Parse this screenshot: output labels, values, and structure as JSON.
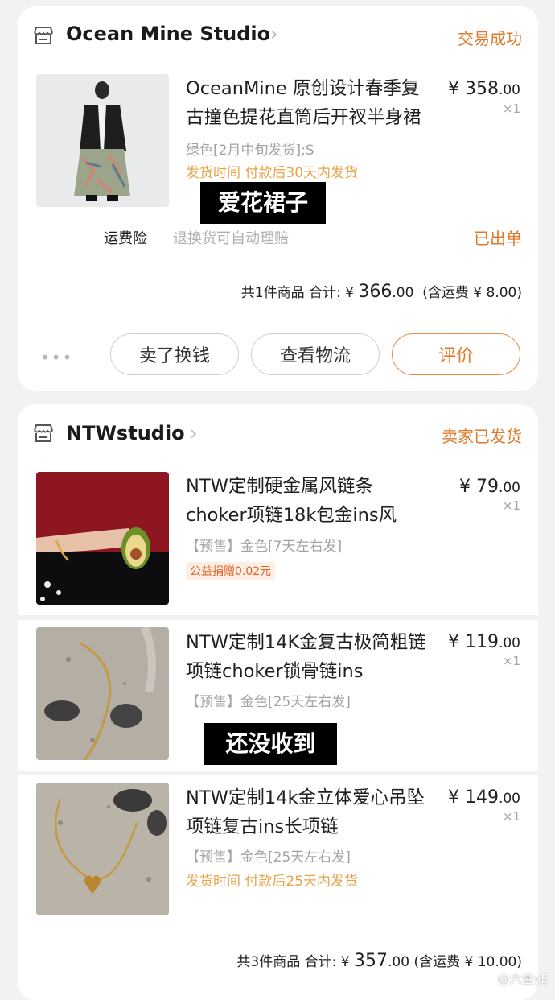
{
  "orders": [
    {
      "shop": {
        "name": "Ocean Mine Studio",
        "status": "交易成功"
      },
      "items": [
        {
          "title": "OceanMine 原创设计春季复古撞色提花直筒后开衩半身裙",
          "spec": "绿色[2月中旬发货];S",
          "ship_time": "发货时间 付款后30天内发货",
          "price_int": "¥ 358",
          "price_dec": ".00",
          "qty": "×1"
        }
      ],
      "overlay": "爱花裙子",
      "insurance": {
        "label": "运费险",
        "desc": "退换货可自动理赔",
        "status": "已出单"
      },
      "summary": {
        "count": "共1件商品",
        "total_label": "合计: ¥",
        "total_int": "366",
        "total_dec": ".00",
        "shipping": "(含运费 ¥ 8.00)"
      },
      "buttons": {
        "more": "•••",
        "sell": "卖了换钱",
        "logistics": "查看物流",
        "review": "评价"
      }
    },
    {
      "shop": {
        "name": "NTWstudio",
        "status": "卖家已发货"
      },
      "items": [
        {
          "title": "NTW定制硬金属风链条 choker项链18k包金ins风",
          "spec": "【预售】金色[7天左右发]",
          "charity": "公益捐赠0.02元",
          "price_int": "¥ 79",
          "price_dec": ".00",
          "qty": "×1"
        },
        {
          "title": "NTW定制14K金复古极简粗链项链choker锁骨链ins",
          "spec": "【预售】金色[25天左右发]",
          "price_int": "¥ 119",
          "price_dec": ".00",
          "qty": "×1"
        },
        {
          "title": "NTW定制14k金立体爱心吊坠项链复古ins长项链",
          "spec": "【预售】金色[25天左右发]",
          "ship_time": "发货时间 付款后25天内发货",
          "price_int": "¥ 149",
          "price_dec": ".00",
          "qty": "×1"
        }
      ],
      "overlay": "还没收到",
      "summary": {
        "count": "共3件商品",
        "total_label": "合计: ¥",
        "total_int": "357",
        "total_dec": ".00",
        "shipping": "(含运费 ¥ 10.00)"
      }
    }
  ],
  "watermark": "@六金yE",
  "icons": {
    "store": "store-icon",
    "chevron": "chevron-right-icon",
    "more": "more-dots-icon"
  },
  "colors": {
    "accent": "#e07a2a",
    "ship_time": "#e9a347",
    "muted": "#a3a3a3"
  }
}
